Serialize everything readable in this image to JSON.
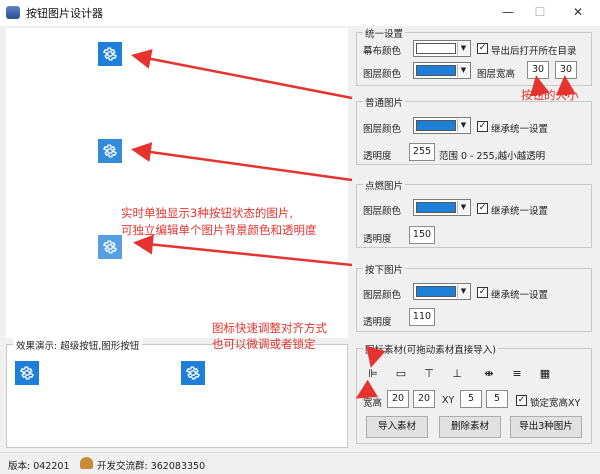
{
  "window": {
    "title": "按钮图片设计器",
    "minimize": "—",
    "maximize": "☐",
    "close": "✕"
  },
  "demo": {
    "legend": "效果演示: 超级按钮,图形按钮"
  },
  "unified": {
    "legend": "统一设置",
    "canvas_color_label": "幕布颜色",
    "layer_color_label": "图层颜色",
    "open_dir_label": "导出后打开所在目录",
    "size_label": "图层宽高",
    "width": "30",
    "height": "30",
    "canvas_color": "#ffffff",
    "layer_color": "#1e7fd8"
  },
  "normal": {
    "legend": "普通图片",
    "layer_color_label": "图层颜色",
    "inherit_label": "继承统一设置",
    "opacity_label": "透明度",
    "opacity": "255",
    "range_text": "范围 0 - 255,越小越透明",
    "layer_color": "#1e7fd8"
  },
  "hover": {
    "legend": "点燃图片",
    "layer_color_label": "图层颜色",
    "inherit_label": "继承统一设置",
    "opacity_label": "透明度",
    "opacity": "150",
    "layer_color": "#1e7fd8"
  },
  "pressed": {
    "legend": "按下图片",
    "layer_color_label": "图层颜色",
    "inherit_label": "继承统一设置",
    "opacity_label": "透明度",
    "opacity": "110",
    "layer_color": "#1e7fd8"
  },
  "material": {
    "legend": "图标素材(可拖动素材直接导入)",
    "wh_label": "宽高",
    "w": "20",
    "h": "20",
    "xy_label": "XY",
    "x": "5",
    "y": "5",
    "lock_label": "锁定宽高XY",
    "import_button": "导入素材",
    "delete_button": "删除素材",
    "export_button": "导出3种图片"
  },
  "status": {
    "version": "版本: 042201",
    "group": "开发交流群: 362083350"
  },
  "annotations": {
    "size_note": "按钮的大小",
    "realtime_line1": "实时单独显示3种按钮状态的图片,",
    "realtime_line2": "可独立编辑单个图片背景颜色和透明度",
    "align_line1": "图标快速调整对齐方式",
    "align_line2": "也可以微调或者锁定"
  },
  "colors": {
    "accent": "#1e7fd8",
    "annotation": "#e5342f"
  }
}
